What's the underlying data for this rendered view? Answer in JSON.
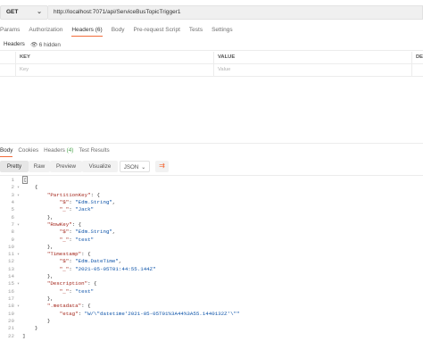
{
  "request": {
    "method": "GET",
    "url": "http://localhost:7071/api/ServiceBusTopicTrigger1",
    "tabs": [
      {
        "label": "Params"
      },
      {
        "label": "Authorization"
      },
      {
        "label": "Headers (6)"
      },
      {
        "label": "Body"
      },
      {
        "label": "Pre-request Script"
      },
      {
        "label": "Tests"
      },
      {
        "label": "Settings"
      }
    ],
    "active_tab": "Headers (6)",
    "headers_label": "Headers",
    "hidden_label": "6 hidden",
    "table": {
      "columns": [
        "KEY",
        "VALUE",
        "DE"
      ],
      "placeholder_key": "Key",
      "placeholder_value": "Value"
    }
  },
  "response": {
    "tabs": {
      "body": "Body",
      "cookies": "Cookies",
      "headers": "Headers",
      "headers_count": "(4)",
      "test_results": "Test Results"
    },
    "toolbar": {
      "pretty": "Pretty",
      "raw": "Raw",
      "preview": "Preview",
      "visualize": "Visualize",
      "format": "JSON"
    },
    "code_lines": [
      {
        "n": "1",
        "fold": "",
        "text": "["
      },
      {
        "n": "2",
        "fold": "▾",
        "text": "    {"
      },
      {
        "n": "3",
        "fold": "▾",
        "text": "        \"PartitionKey\": {"
      },
      {
        "n": "4",
        "fold": "",
        "text": "            \"$\": \"Edm.String\","
      },
      {
        "n": "5",
        "fold": "",
        "text": "            \"_\": \"Jack\""
      },
      {
        "n": "6",
        "fold": "",
        "text": "        },"
      },
      {
        "n": "7",
        "fold": "▾",
        "text": "        \"RowKey\": {"
      },
      {
        "n": "8",
        "fold": "",
        "text": "            \"$\": \"Edm.String\","
      },
      {
        "n": "9",
        "fold": "",
        "text": "            \"_\": \"test\""
      },
      {
        "n": "10",
        "fold": "",
        "text": "        },"
      },
      {
        "n": "11",
        "fold": "▾",
        "text": "        \"Timestamp\": {"
      },
      {
        "n": "12",
        "fold": "",
        "text": "            \"$\": \"Edm.DateTime\","
      },
      {
        "n": "13",
        "fold": "",
        "text": "            \"_\": \"2021-05-05T01:44:55.144Z\""
      },
      {
        "n": "14",
        "fold": "",
        "text": "        },"
      },
      {
        "n": "15",
        "fold": "▾",
        "text": "        \"Description\": {"
      },
      {
        "n": "16",
        "fold": "",
        "text": "            \"_\": \"test\""
      },
      {
        "n": "17",
        "fold": "",
        "text": "        },"
      },
      {
        "n": "18",
        "fold": "▾",
        "text": "        \".metadata\": {"
      },
      {
        "n": "19",
        "fold": "",
        "text": "            \"etag\": \"W/\\\"datetime'2021-05-05T01%3A44%3A55.1440132Z'\\\"\""
      },
      {
        "n": "20",
        "fold": "",
        "text": "        }"
      },
      {
        "n": "21",
        "fold": "",
        "text": "    }"
      },
      {
        "n": "22",
        "fold": "",
        "text": "]"
      }
    ]
  },
  "colors": {
    "accent": "#f26b3a",
    "json_key": "#a3251a",
    "json_string": "#0b52a8",
    "count_green": "#49a24c"
  },
  "icons": [
    "chevron-down-icon",
    "wrap-lines-icon",
    "fold-arrow-icon"
  ]
}
